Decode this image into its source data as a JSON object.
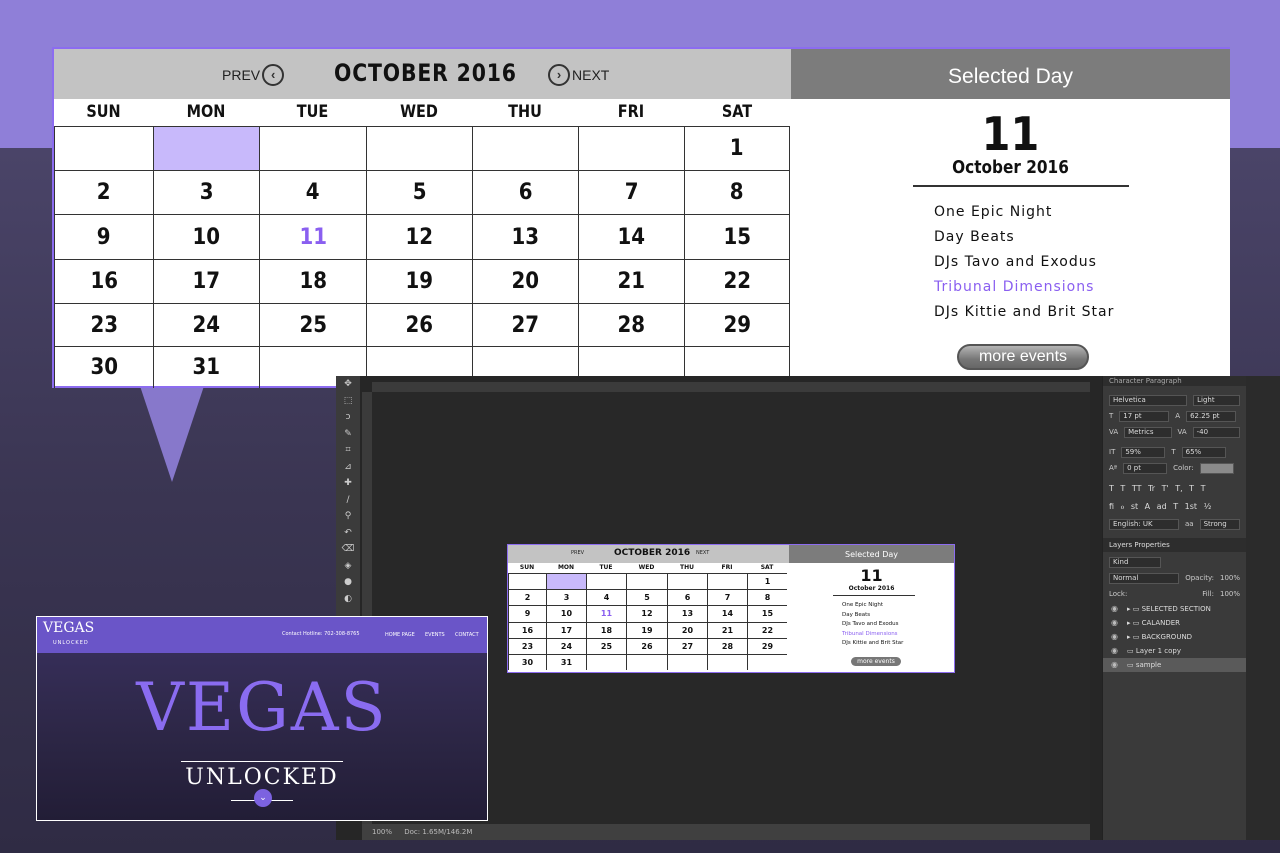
{
  "calendar": {
    "prev_label": "PREV",
    "next_label": "NEXT",
    "month_title": "OCTOBER  2016",
    "weekdays": [
      "SUN",
      "MON",
      "TUE",
      "WED",
      "THU",
      "FRI",
      "SAT"
    ],
    "weeks": [
      [
        "",
        "",
        "",
        "",
        "",
        "",
        "1"
      ],
      [
        "2",
        "3",
        "4",
        "5",
        "6",
        "7",
        "8"
      ],
      [
        "9",
        "10",
        "11",
        "12",
        "13",
        "14",
        "15"
      ],
      [
        "16",
        "17",
        "18",
        "19",
        "20",
        "21",
        "22"
      ],
      [
        "23",
        "24",
        "25",
        "26",
        "27",
        "28",
        "29"
      ],
      [
        "30",
        "31",
        "",
        "",
        "",
        "",
        ""
      ]
    ],
    "highlight_color": "#c8b9fb",
    "accent_color": "#8a5ff0"
  },
  "selected_day": {
    "header": "Selected Day",
    "day": "11",
    "month_year": "October 2016",
    "events": [
      "One Epic Night",
      "Day Beats",
      "DJs Tavo and Exodus",
      "Tribunal Dimensions",
      "DJs Kittie and Brit Star"
    ],
    "active_event_index": 3,
    "more_button": "more events"
  },
  "photoshop": {
    "panel_tabs": "Character   Paragraph",
    "font_family": "Helvetica",
    "font_style": "Light",
    "font_size": "17 pt",
    "leading": "62.25 pt",
    "kerning": "Metrics",
    "tracking": "-40",
    "vscale": "59%",
    "hscale": "65%",
    "baseline": "0 pt",
    "color_label": "Color:",
    "type_symbols": "T T TT Tr T' T, T T",
    "opentype_symbols": "fi ℴ st A ad T 1st ½",
    "language": "English: UK",
    "aa_label": "aa",
    "aa_mode": "Strong",
    "layers_tabs": "Layers   Properties",
    "kind_label": "Kind",
    "blend_label": "Normal",
    "opacity_label": "Opacity:",
    "opacity_value": "100%",
    "lock_label": "Lock:",
    "fill_label": "Fill:",
    "fill_value": "100%",
    "layers": [
      "SELECTED SECTION",
      "CALANDER",
      "BACKGROUND",
      "Layer 1 copy",
      "sample"
    ],
    "zoom": "100%",
    "doc_info": "Doc: 1.65M/146.2M"
  },
  "vegas": {
    "logo": "VEGAS",
    "logo_sub": "UNLOCKED",
    "contact": "Contact Hotline: 702-308-8765",
    "nav": [
      "HOME PAGE",
      "EVENTS",
      "CONTACT"
    ],
    "hero_title": "VEGAS",
    "hero_sub": "UNLOCKED"
  }
}
